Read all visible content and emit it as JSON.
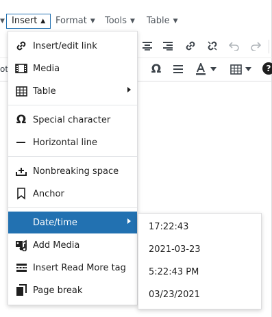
{
  "menubar": {
    "items": [
      {
        "label": "Insert",
        "active": true
      },
      {
        "label": "Format",
        "active": false
      },
      {
        "label": "Tools",
        "active": false
      },
      {
        "label": "Table",
        "active": false
      }
    ],
    "caret_down": "▼",
    "caret_up": "▲"
  },
  "toolbar": {
    "partial_label": "ot",
    "help_label": "?"
  },
  "insert_menu": {
    "items": [
      {
        "label": "Insert/edit link",
        "icon": "link-icon"
      },
      {
        "label": "Media",
        "icon": "film-icon"
      },
      {
        "label": "Table",
        "icon": "table-icon",
        "submenu": true
      },
      {
        "label": "Special character",
        "icon": "omega-icon"
      },
      {
        "label": "Horizontal line",
        "icon": "horizontal-line-icon"
      },
      {
        "label": "Nonbreaking space",
        "icon": "nonbreaking-space-icon"
      },
      {
        "label": "Anchor",
        "icon": "bookmark-icon"
      },
      {
        "label": "Date/time",
        "icon": "",
        "submenu": true,
        "selected": true
      },
      {
        "label": "Add Media",
        "icon": "add-media-icon"
      },
      {
        "label": "Insert Read More tag",
        "icon": "read-more-icon"
      },
      {
        "label": "Page break",
        "icon": "page-break-icon"
      }
    ]
  },
  "datetime_submenu": {
    "items": [
      "17:22:43",
      "2021-03-23",
      "5:22:43 PM",
      "03/23/2021"
    ]
  },
  "colors": {
    "accent": "#2271b1",
    "text": "#1e1e1e",
    "muted": "#50575e"
  }
}
